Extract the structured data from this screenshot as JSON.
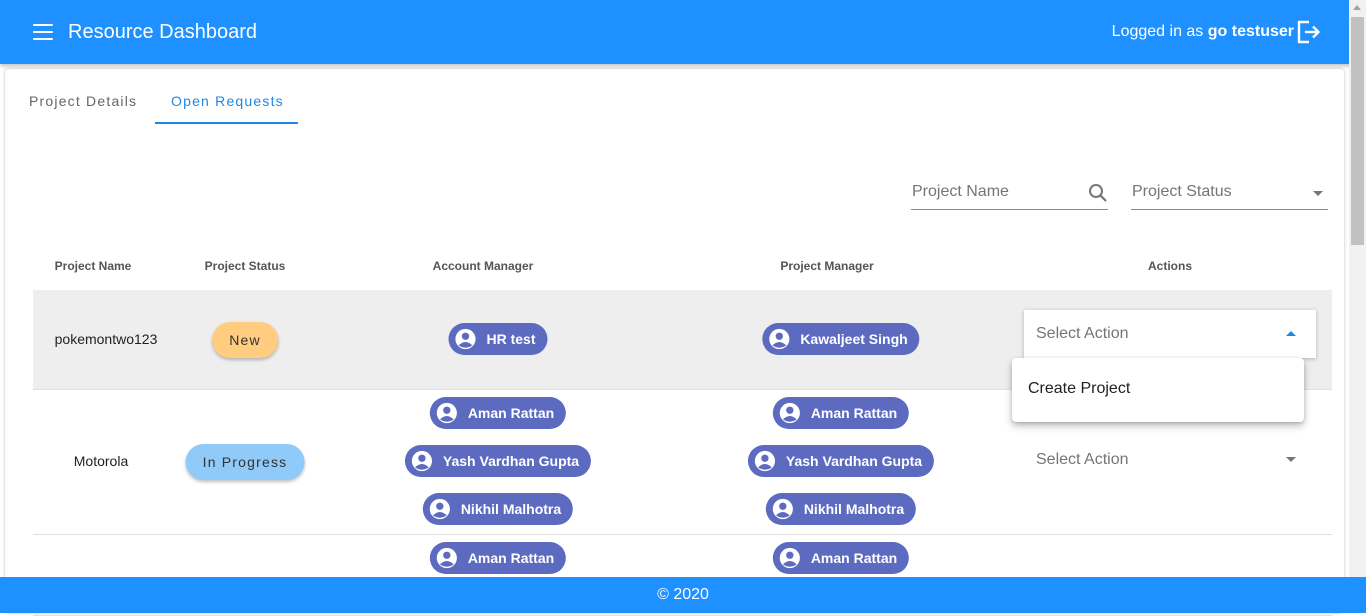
{
  "header": {
    "title": "Resource Dashboard",
    "login_prefix": "Logged in as ",
    "username": "go testuser",
    "menu_icon": "menu-icon",
    "logout_icon": "logout-icon",
    "color": "#1e90ff"
  },
  "tabs": [
    {
      "label": "Project Details",
      "active": false
    },
    {
      "label": "Open Requests",
      "active": true
    }
  ],
  "filters": {
    "project_name_placeholder": "Project Name",
    "project_status_placeholder": "Project Status"
  },
  "table": {
    "headers": [
      "Project Name",
      "Project Status",
      "Account Manager",
      "Project Manager",
      "Actions"
    ],
    "rows": [
      {
        "project_name": "pokemontwo123",
        "status": "New",
        "status_color": "#ffcc80",
        "account_managers": [
          "HR test"
        ],
        "project_managers": [
          "Kawaljeet Singh"
        ],
        "action": "Select Action"
      },
      {
        "project_name": "Motorola",
        "status": "In Progress",
        "status_color": "#90caf9",
        "account_managers": [
          "Aman Rattan",
          "Yash Vardhan Gupta",
          "Nikhil Malhotra"
        ],
        "project_managers": [
          "Aman Rattan",
          "Yash Vardhan Gupta",
          "Nikhil Malhotra"
        ],
        "action": "Select Action"
      },
      {
        "account_managers": [
          "Aman Rattan"
        ],
        "project_managers": [
          "Aman Rattan"
        ]
      }
    ]
  },
  "dropdown": {
    "items": [
      "Create Project"
    ]
  },
  "footer": {
    "text": "© 2020"
  },
  "chip_color": "#5c6bc0"
}
